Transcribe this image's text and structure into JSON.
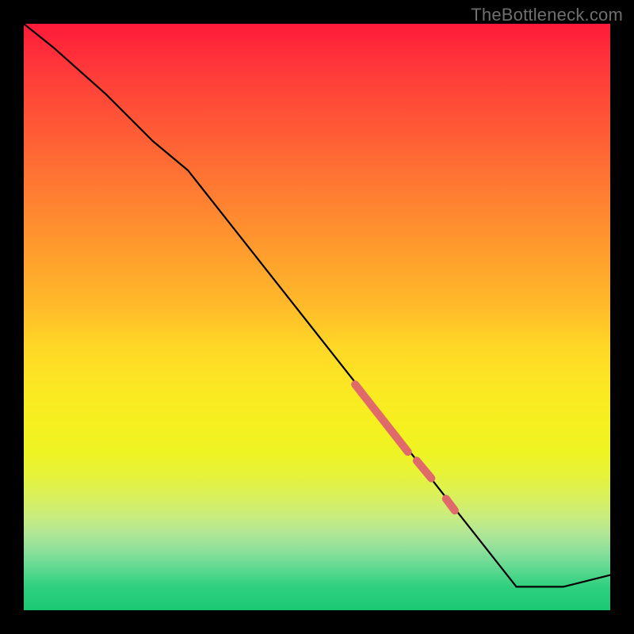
{
  "watermark": "TheBottleneck.com",
  "chart_data": {
    "type": "line",
    "title": "",
    "xlabel": "",
    "ylabel": "",
    "x_range": [
      0,
      100
    ],
    "y_range": [
      0,
      100
    ],
    "grid": false,
    "curve": {
      "name": "bottleneck-curve",
      "x": [
        0,
        5,
        14,
        22,
        28,
        84,
        92,
        100
      ],
      "y": [
        100,
        96,
        88,
        80,
        75,
        4,
        4,
        6
      ]
    },
    "marker_segments": [
      {
        "x": [
          56.5,
          65.5
        ],
        "y": [
          38.5,
          27.0
        ]
      },
      {
        "x": [
          67.0,
          69.5
        ],
        "y": [
          25.5,
          22.5
        ]
      },
      {
        "x": [
          72.0,
          73.5
        ],
        "y": [
          19.0,
          17.0
        ]
      }
    ],
    "colors": {
      "curve_stroke": "#000000",
      "marker_stroke": "#e06a6a",
      "gradient_top": "#ff1a3a",
      "gradient_bottom": "#1ac873",
      "page_background": "#000000"
    }
  }
}
